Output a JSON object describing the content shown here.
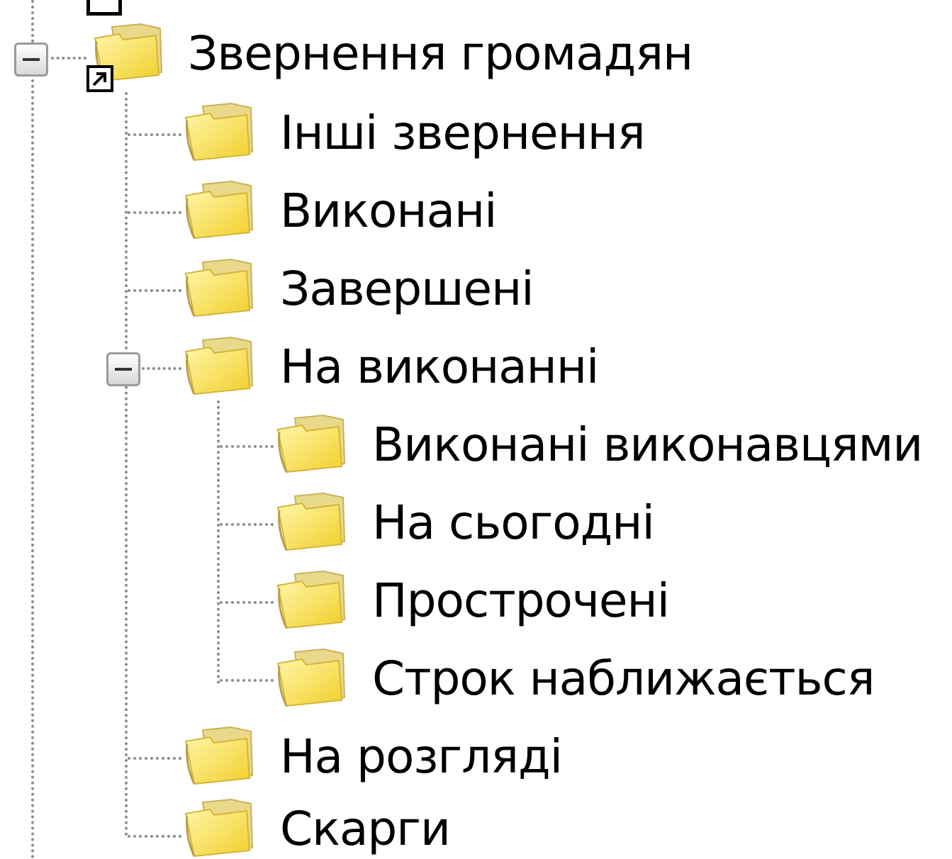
{
  "tree": {
    "root": {
      "label": "Звернення громадян",
      "expanded": true,
      "children": [
        {
          "label": "Інші звернення"
        },
        {
          "label": "Виконані"
        },
        {
          "label": "Завершені"
        },
        {
          "label": "На виконанні",
          "expanded": true,
          "children": [
            {
              "label": "Виконані виконавцями"
            },
            {
              "label": "На сьогодні"
            },
            {
              "label": "Прострочені"
            },
            {
              "label": "Строк наближається"
            }
          ]
        },
        {
          "label": "На розгляді"
        },
        {
          "label": "Скарги"
        }
      ]
    },
    "icons": {
      "folder": "folder-icon",
      "collapse": "minus-box-icon",
      "shortcut": "shortcut-arrow-icon"
    },
    "colors": {
      "folder_light": "#fff6a8",
      "folder_dark": "#f2cf2a",
      "connector": "#8c8c8c"
    }
  }
}
